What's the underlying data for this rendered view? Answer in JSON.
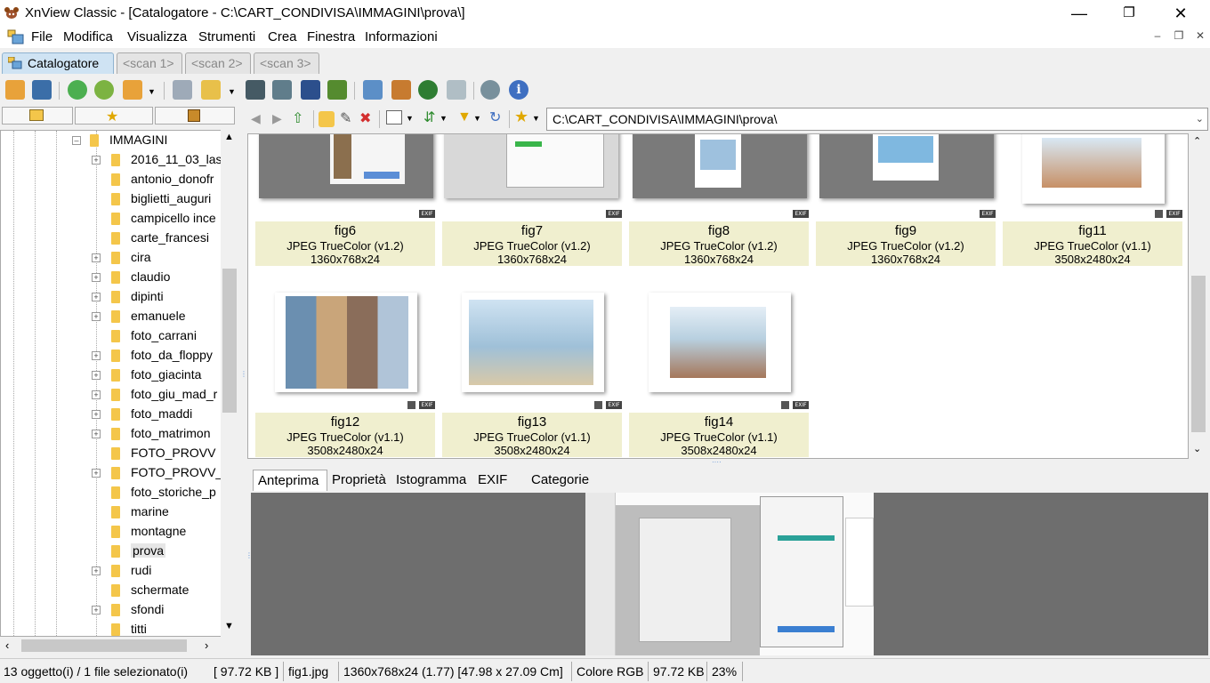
{
  "window": {
    "title": "XnView Classic - [Catalogatore - C:\\CART_CONDIVISA\\IMMAGINI\\prova\\]"
  },
  "menu": [
    "File",
    "Modifica",
    "Visualizza",
    "Strumenti",
    "Crea",
    "Finestra",
    "Informazioni"
  ],
  "tabs": [
    {
      "label": "Catalogatore",
      "active": true
    },
    {
      "label": "<scan 1>",
      "active": false
    },
    {
      "label": "<scan 2>",
      "active": false
    },
    {
      "label": "<scan 3>",
      "active": false
    }
  ],
  "tree": {
    "root": "IMMAGINI",
    "items": [
      {
        "label": "2016_11_03_las",
        "expandable": true
      },
      {
        "label": "antonio_donofr",
        "expandable": false
      },
      {
        "label": "biglietti_auguri",
        "expandable": false
      },
      {
        "label": "campicello ince",
        "expandable": false
      },
      {
        "label": "carte_francesi",
        "expandable": false
      },
      {
        "label": "cira",
        "expandable": true
      },
      {
        "label": "claudio",
        "expandable": true
      },
      {
        "label": "dipinti",
        "expandable": true
      },
      {
        "label": "emanuele",
        "expandable": true
      },
      {
        "label": "foto_carrani",
        "expandable": false
      },
      {
        "label": "foto_da_floppy",
        "expandable": true
      },
      {
        "label": "foto_giacinta",
        "expandable": true
      },
      {
        "label": "foto_giu_mad_r",
        "expandable": true
      },
      {
        "label": "foto_maddi",
        "expandable": true
      },
      {
        "label": "foto_matrimon",
        "expandable": true
      },
      {
        "label": "FOTO_PROVV",
        "expandable": false
      },
      {
        "label": "FOTO_PROVV_2",
        "expandable": true
      },
      {
        "label": "foto_storiche_p",
        "expandable": false
      },
      {
        "label": "marine",
        "expandable": false
      },
      {
        "label": "montagne",
        "expandable": false
      },
      {
        "label": "prova",
        "expandable": false,
        "selected": true
      },
      {
        "label": "rudi",
        "expandable": true
      },
      {
        "label": "schermate",
        "expandable": false
      },
      {
        "label": "sfondi",
        "expandable": true
      },
      {
        "label": "titti",
        "expandable": false
      }
    ]
  },
  "path": "C:\\CART_CONDIVISA\\IMMAGINI\\prova\\",
  "files": [
    {
      "name": "fig6",
      "format": "JPEG TrueColor (v1.2)",
      "dims": "1360x768x24",
      "badge": "EXIF"
    },
    {
      "name": "fig7",
      "format": "JPEG TrueColor (v1.2)",
      "dims": "1360x768x24",
      "badge": "EXIF"
    },
    {
      "name": "fig8",
      "format": "JPEG TrueColor (v1.2)",
      "dims": "1360x768x24",
      "badge": "EXIF"
    },
    {
      "name": "fig9",
      "format": "JPEG TrueColor (v1.2)",
      "dims": "1360x768x24",
      "badge": "EXIF"
    },
    {
      "name": "fig11",
      "format": "JPEG TrueColor (v1.1)",
      "dims": "3508x2480x24",
      "badge": "EXIF"
    },
    {
      "name": "fig12",
      "format": "JPEG TrueColor (v1.1)",
      "dims": "3508x2480x24",
      "badge": "EXIF"
    },
    {
      "name": "fig13",
      "format": "JPEG TrueColor (v1.1)",
      "dims": "3508x2480x24",
      "badge": "EXIF"
    },
    {
      "name": "fig14",
      "format": "JPEG TrueColor (v1.1)",
      "dims": "3508x2480x24",
      "badge": "EXIF"
    }
  ],
  "panel_tabs": [
    {
      "label": "Anteprima",
      "active": true
    },
    {
      "label": "Proprietà",
      "active": false
    },
    {
      "label": "Istogramma",
      "active": false
    },
    {
      "label": "EXIF",
      "active": false
    },
    {
      "label": "Categorie",
      "active": false
    }
  ],
  "status": {
    "count": "13 oggetto(i) / 1 file selezionato(i)",
    "size": "[ 97.72 KB ]",
    "file": "fig1.jpg",
    "dims": "1360x768x24 (1.77) [47.98 x 27.09 Cm]",
    "color": "Colore RGB",
    "filesize": "97.72 KB",
    "zoom": "23%"
  }
}
